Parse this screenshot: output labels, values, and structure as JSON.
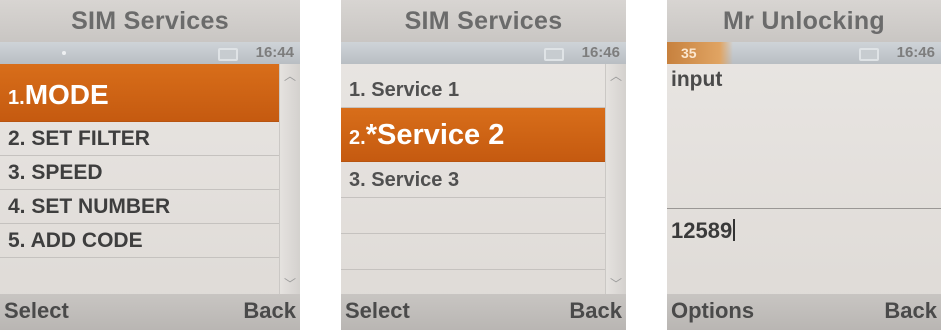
{
  "screens": [
    {
      "title": "SIM Services",
      "status": {
        "time": "16:44"
      },
      "menu": [
        {
          "num": "1.",
          "label": "MODE"
        },
        {
          "num": "2.",
          "label": "SET FILTER"
        },
        {
          "num": "3.",
          "label": "SPEED"
        },
        {
          "num": "4.",
          "label": "SET NUMBER"
        },
        {
          "num": "5.",
          "label": "ADD CODE"
        }
      ],
      "selected_index": 0,
      "softkeys": {
        "left": "Select",
        "right": "Back"
      }
    },
    {
      "title": "SIM Services",
      "status": {
        "time": "16:46"
      },
      "menu": [
        {
          "num": "1.",
          "label": "Service 1"
        },
        {
          "num": "2.",
          "label": "*Service 2"
        },
        {
          "num": "3.",
          "label": "Service 3"
        }
      ],
      "selected_index": 1,
      "softkeys": {
        "left": "Select",
        "right": "Back"
      }
    },
    {
      "title": "Mr Unlocking",
      "status": {
        "time": "16:46",
        "counter": "35"
      },
      "input_label": "input",
      "input_value": "12589",
      "softkeys": {
        "left": "Options",
        "right": "Back"
      }
    }
  ],
  "colors": {
    "selection": "#cf6414",
    "title_text": "#6b6b6b",
    "screen_bg": "#e4e1de"
  }
}
